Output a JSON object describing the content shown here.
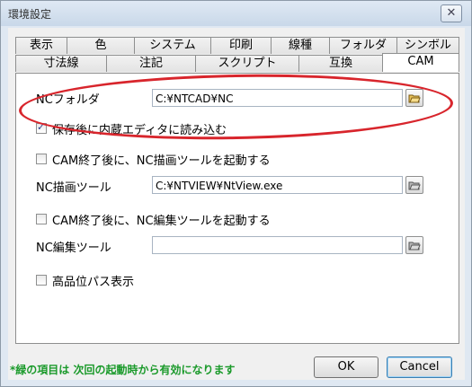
{
  "window": {
    "title": "環境設定"
  },
  "tabs_top": [
    "表示",
    "色",
    "システム",
    "印刷",
    "線種",
    "フォルダ",
    "シンボル"
  ],
  "tabs_bottom": [
    "寸法線",
    "注記",
    "スクリプト",
    "互換",
    "CAM"
  ],
  "active_tab": "CAM",
  "form": {
    "nc_folder_label": "NCフォルダ",
    "nc_folder_value": "C:¥NTCAD¥NC",
    "save_embed_label": "保存後に内蔵エディタに読み込む",
    "save_embed_checked": true,
    "launch_draw_label": "CAM終了後に、NC描画ツールを起動する",
    "launch_draw_checked": false,
    "draw_tool_label": "NC描画ツール",
    "draw_tool_value": "C:¥NTVIEW¥NtView.exe",
    "launch_edit_label": "CAM終了後に、NC編集ツールを起動する",
    "launch_edit_checked": false,
    "edit_tool_label": "NC編集ツール",
    "edit_tool_value": "",
    "hq_path_label": "高品位パス表示",
    "hq_path_checked": false
  },
  "footer": {
    "note": "*緑の項目は 次回の起動時から有効になります",
    "ok_label": "OK",
    "cancel_label": "Cancel"
  },
  "colors": {
    "annotation": "#d8252c",
    "note": "#1b9a2b"
  }
}
